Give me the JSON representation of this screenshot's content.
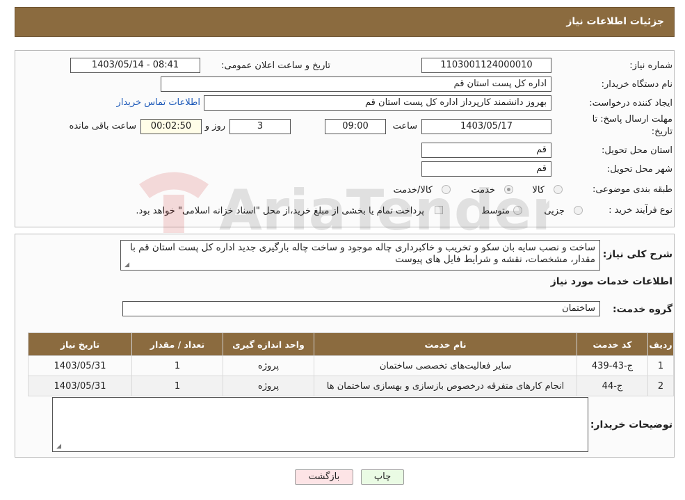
{
  "header": {
    "title": "جزئیات اطلاعات نیاز"
  },
  "info": {
    "need_number_label": "شماره نیاز:",
    "need_number": "1103001124000010",
    "announce_label": "تاریخ و ساعت اعلان عمومی:",
    "announce_value": "1403/05/14 - 08:41",
    "buyer_org_label": "نام دستگاه خریدار:",
    "buyer_org": "اداره کل پست استان قم",
    "creator_label": "ایجاد کننده درخواست:",
    "creator": "بهروز دانشمند کارپرداز اداره کل پست استان قم",
    "contact_link": "اطلاعات تماس خریدار",
    "deadline_label_1": "مهلت ارسال پاسخ: تا",
    "deadline_label_2": "تاریخ:",
    "deadline_date": "1403/05/17",
    "time_label": "ساعت",
    "deadline_time": "09:00",
    "days_value": "3",
    "days_label": "روز و",
    "remaining_time": "00:02:50",
    "remaining_label": "ساعت باقی مانده",
    "province_label": "استان محل تحویل:",
    "province": "قم",
    "city_label": "شهر محل تحویل:",
    "city": "قم",
    "category_label": "طبقه بندی موضوعی:",
    "category_options": [
      "کالا",
      "خدمت",
      "کالا/خدمت"
    ],
    "category_selected": "خدمت",
    "process_label": "نوع فرآیند خرید :",
    "process_options": [
      "جزیی",
      "متوسط"
    ],
    "payment_note": "پرداخت تمام یا بخشی از مبلغ خرید،از محل \"اسناد خزانه اسلامی\" خواهد بود."
  },
  "description": {
    "label": "شرح کلی نیاز:",
    "text": "ساخت و نصب سایه بان سکو و تخریب و خاکبرداری چاله موجود و ساخت چاله بارگیری جدید اداره کل پست استان قم با مقدار، مشخصات، نقشه و شرایط فایل های پیوست"
  },
  "services": {
    "section_title": "اطلاعات خدمات مورد نیاز",
    "group_label": "گروه خدمت:",
    "group_value": "ساختمان",
    "columns": [
      "ردیف",
      "کد خدمت",
      "نام خدمت",
      "واحد اندازه گیری",
      "تعداد / مقدار",
      "تاریخ نیاز"
    ],
    "rows": [
      [
        "1",
        "ج-43-439",
        "سایر فعالیت‌های تخصصی ساختمان",
        "پروژه",
        "1",
        "1403/05/31"
      ],
      [
        "2",
        "ج-44",
        "انجام کارهای متفرقه درخصوص بازسازی و بهسازی ساختمان ها",
        "پروژه",
        "1",
        "1403/05/31"
      ]
    ]
  },
  "buyer_notes": {
    "label": "توضیحات خریدار:",
    "value": ""
  },
  "buttons": {
    "print": "چاپ",
    "back": "بازگشت"
  },
  "watermark": {
    "text": "AriaTender.neT"
  },
  "colors": {
    "header_bg": "#8b6b3f",
    "link": "#1a57b8",
    "print_bg": "#eafbe4",
    "back_bg": "#fde4e6"
  }
}
